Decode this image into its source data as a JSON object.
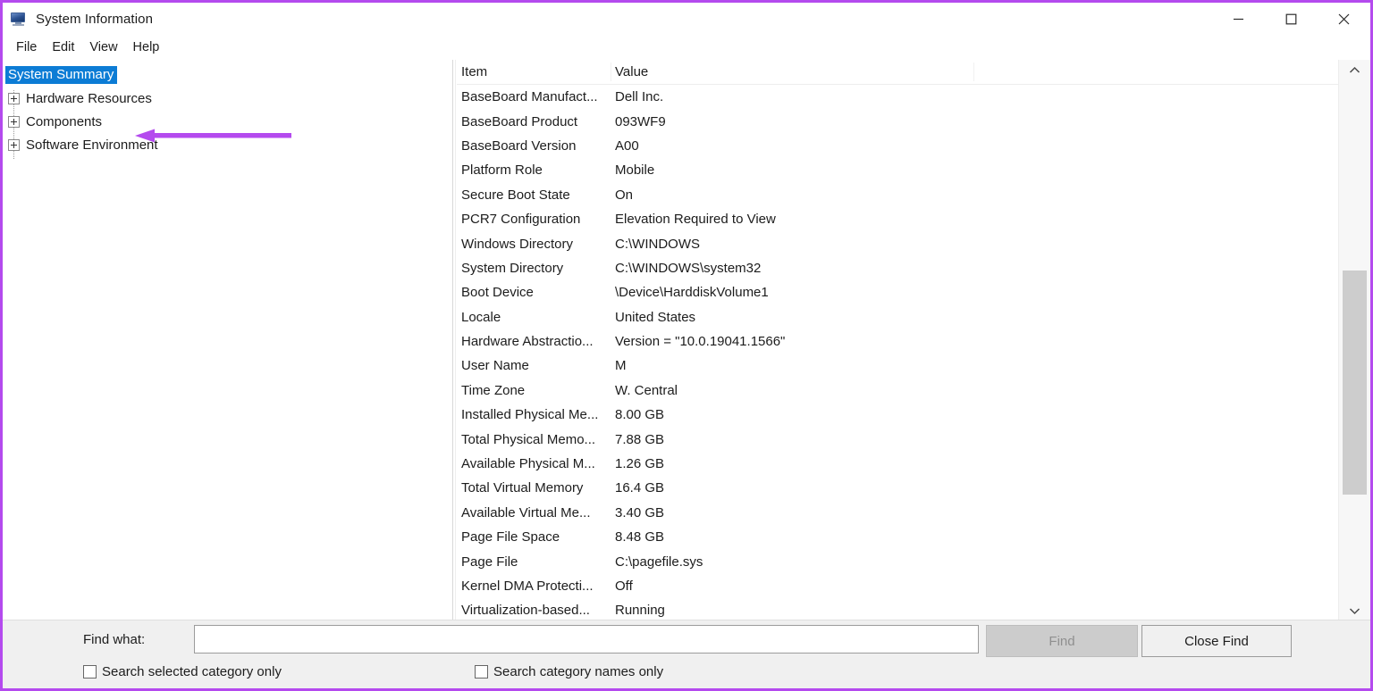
{
  "window": {
    "title": "System Information",
    "icon": "computer-monitor-icon",
    "accent_border": "#b44aee",
    "controls": [
      {
        "name": "minimize",
        "glyph": "minimize-icon"
      },
      {
        "name": "maximize",
        "glyph": "maximize-icon"
      },
      {
        "name": "close",
        "glyph": "close-icon"
      }
    ]
  },
  "menubar": {
    "items": [
      {
        "label": "File"
      },
      {
        "label": "Edit"
      },
      {
        "label": "View"
      },
      {
        "label": "Help"
      }
    ]
  },
  "tree": {
    "items": [
      {
        "label": "System Summary",
        "selected": true,
        "expandable": false
      },
      {
        "label": "Hardware Resources",
        "selected": false,
        "expandable": true
      },
      {
        "label": "Components",
        "selected": false,
        "expandable": true
      },
      {
        "label": "Software Environment",
        "selected": false,
        "expandable": true
      }
    ],
    "selection_color": "#0c7cd5"
  },
  "annotation": {
    "type": "arrow",
    "color": "#b44aee",
    "points_to": "System Summary"
  },
  "table": {
    "columns": [
      "Item",
      "Value"
    ],
    "rows": [
      {
        "item": "BaseBoard Manufact...",
        "value": "Dell Inc."
      },
      {
        "item": "BaseBoard Product",
        "value": "093WF9"
      },
      {
        "item": "BaseBoard Version",
        "value": "A00"
      },
      {
        "item": "Platform Role",
        "value": "Mobile"
      },
      {
        "item": "Secure Boot State",
        "value": "On"
      },
      {
        "item": "PCR7 Configuration",
        "value": "Elevation Required to View"
      },
      {
        "item": "Windows Directory",
        "value": "C:\\WINDOWS"
      },
      {
        "item": "System Directory",
        "value": "C:\\WINDOWS\\system32"
      },
      {
        "item": "Boot Device",
        "value": "\\Device\\HarddiskVolume1"
      },
      {
        "item": "Locale",
        "value": "United States"
      },
      {
        "item": "Hardware Abstractio...",
        "value": "Version = \"10.0.19041.1566\""
      },
      {
        "item": "User Name",
        "value": "M"
      },
      {
        "item": "Time Zone",
        "value": "W. Central"
      },
      {
        "item": "Installed Physical Me...",
        "value": "8.00 GB"
      },
      {
        "item": "Total Physical Memo...",
        "value": "7.88 GB"
      },
      {
        "item": "Available Physical M...",
        "value": "1.26 GB"
      },
      {
        "item": "Total Virtual Memory",
        "value": "16.4 GB"
      },
      {
        "item": "Available Virtual Me...",
        "value": "3.40 GB"
      },
      {
        "item": "Page File Space",
        "value": "8.48 GB"
      },
      {
        "item": "Page File",
        "value": "C:\\pagefile.sys"
      },
      {
        "item": "Kernel DMA Protecti...",
        "value": "Off"
      },
      {
        "item": "Virtualization-based...",
        "value": "Running"
      }
    ]
  },
  "scrollbar": {
    "up_icon": "chevron-up-icon",
    "down_icon": "chevron-down-icon",
    "thumb_top_pct": 34,
    "thumb_height_pct": 40
  },
  "findbar": {
    "label": "Find what:",
    "input_value": "",
    "input_placeholder": "",
    "find_button": "Find",
    "find_button_enabled": false,
    "close_find_button": "Close Find",
    "checkbox_selected_category": "Search selected category only",
    "checkbox_selected_category_checked": false,
    "checkbox_category_names": "Search category names only",
    "checkbox_category_names_checked": false
  }
}
